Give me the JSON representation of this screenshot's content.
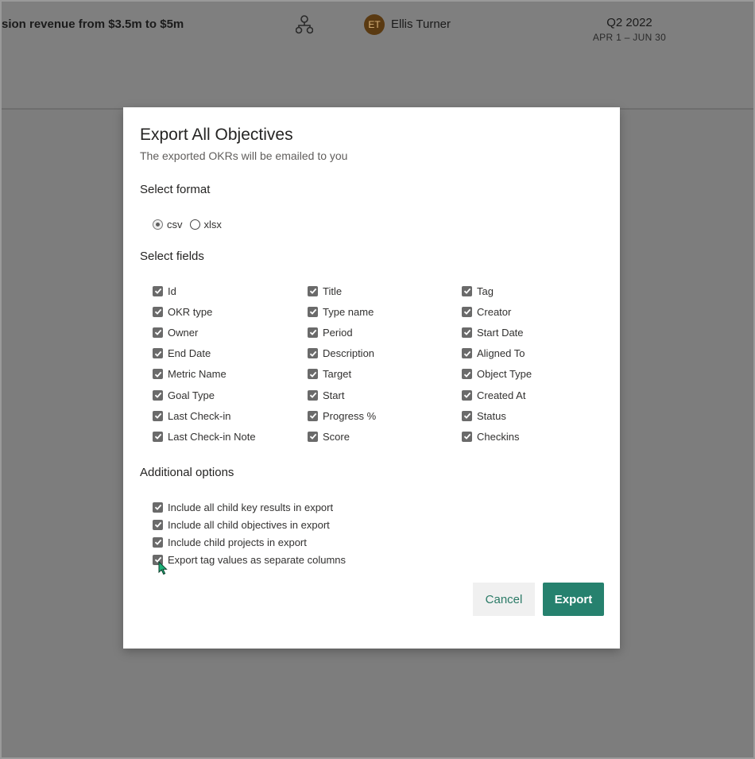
{
  "background": {
    "objective_title": "sion revenue from $3.5m to $5m",
    "align_icon": "hierarchy-icon",
    "owner_initials": "ET",
    "owner_name": "Ellis Turner",
    "quarter": "Q2 2022",
    "dates": "APR 1 – JUN 30"
  },
  "dialog": {
    "title": "Export All Objectives",
    "subtitle": "The exported OKRs will be emailed to you",
    "format_label": "Select format",
    "formats": [
      {
        "label": "csv",
        "selected": true
      },
      {
        "label": "xlsx",
        "selected": false
      }
    ],
    "fields_label": "Select fields",
    "fields": [
      [
        "Id",
        "Title",
        "Tag"
      ],
      [
        "OKR type",
        "Type name",
        "Creator"
      ],
      [
        "Owner",
        "Period",
        "Start Date"
      ],
      [
        "End Date",
        "Description",
        "Aligned To"
      ],
      [
        "Metric Name",
        "Target",
        "Object Type"
      ],
      [
        "Goal Type",
        "Start",
        "Created At"
      ],
      [
        "Last Check-in",
        "Progress %",
        "Status"
      ],
      [
        "Last Check-in Note",
        "Score",
        "Checkins"
      ]
    ],
    "additional_label": "Additional options",
    "options": [
      "Include all child key results in export",
      "Include all child objectives in export",
      "Include child projects in export",
      "Export tag values as separate columns"
    ],
    "cancel_label": "Cancel",
    "export_label": "Export"
  },
  "colors": {
    "accent": "#26816e",
    "overlay": "#7d7d7d",
    "checkbox": "#6a6a6a"
  }
}
